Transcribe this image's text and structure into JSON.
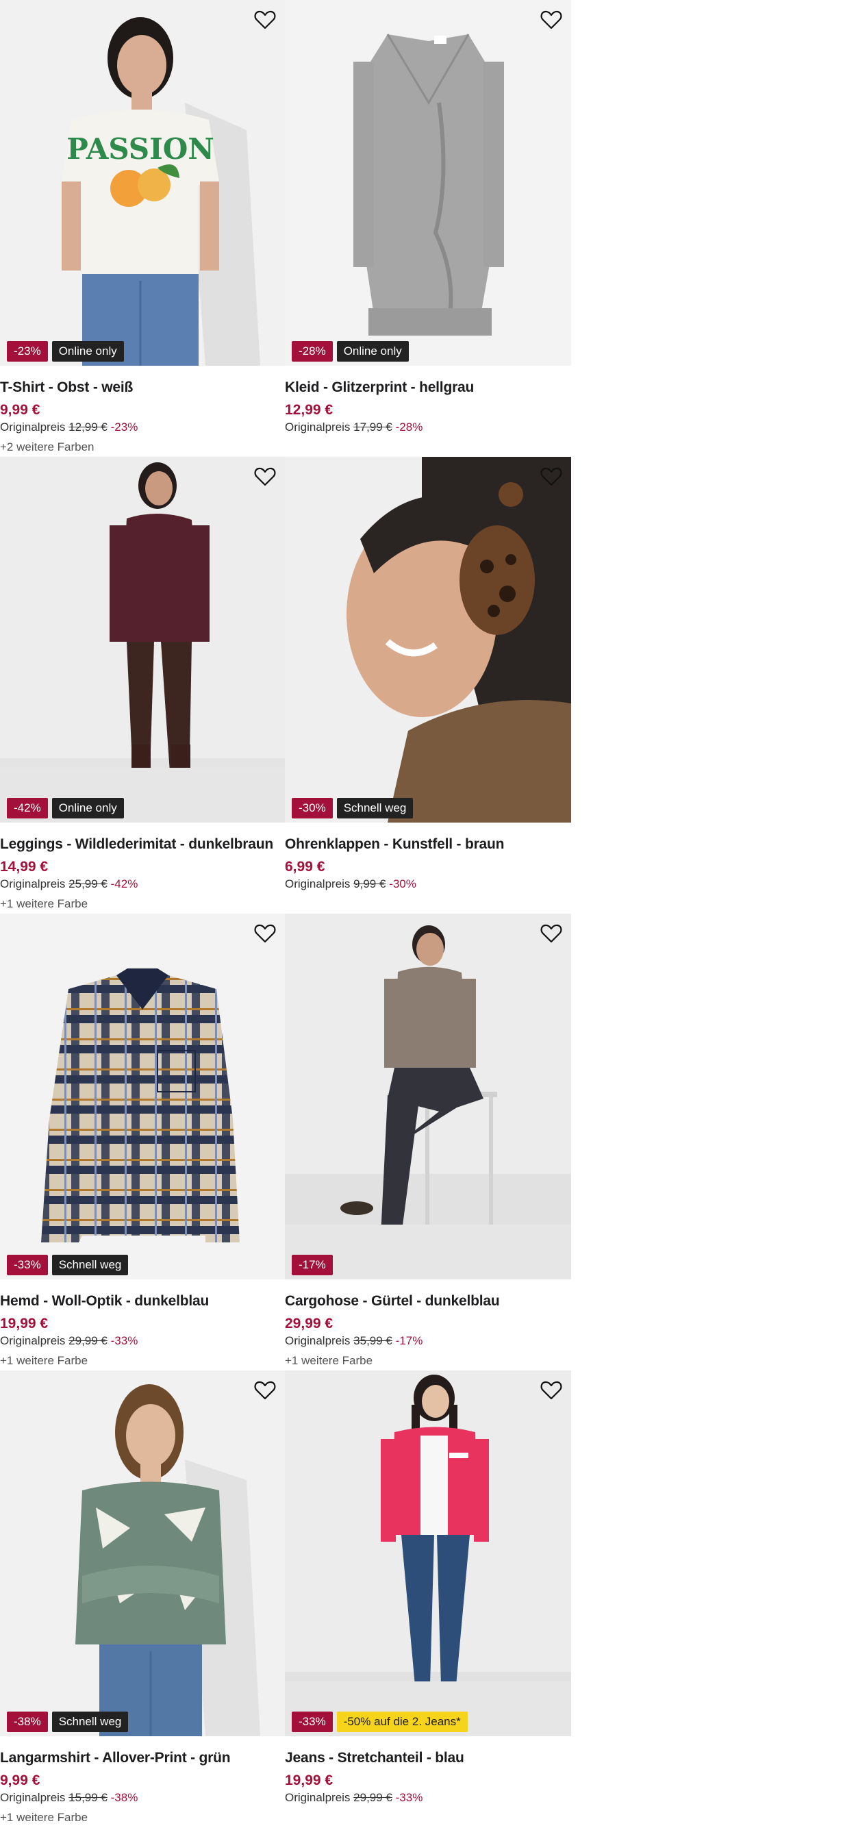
{
  "products": [
    {
      "title": "T-Shirt - Obst - weiß",
      "price": "9,99 €",
      "orig_label": "Originalpreis",
      "orig_price": "12,99 €",
      "discount": "-23%",
      "badge_sale": "-23%",
      "badge_info": "Online only",
      "colors": "+2 weitere Farben",
      "icon": "heart-icon"
    },
    {
      "title": "Kleid - Glitzerprint - hellgrau",
      "price": "12,99 €",
      "orig_label": "Originalpreis",
      "orig_price": "17,99 €",
      "discount": "-28%",
      "badge_sale": "-28%",
      "badge_info": "Online only",
      "colors": "",
      "icon": "heart-icon"
    },
    {
      "title": "Leggings - Wildlederimitat - dunkelbraun",
      "price": "14,99 €",
      "orig_label": "Originalpreis",
      "orig_price": "25,99 €",
      "discount": "-42%",
      "badge_sale": "-42%",
      "badge_info": "Online only",
      "colors": "+1 weitere Farbe",
      "icon": "heart-icon"
    },
    {
      "title": "Ohrenklappen - Kunstfell - braun",
      "price": "6,99 €",
      "orig_label": "Originalpreis",
      "orig_price": "9,99 €",
      "discount": "-30%",
      "badge_sale": "-30%",
      "badge_info": "Schnell weg",
      "colors": "",
      "icon": "heart-icon"
    },
    {
      "title": "Hemd - Woll-Optik - dunkelblau",
      "price": "19,99 €",
      "orig_label": "Originalpreis",
      "orig_price": "29,99 €",
      "discount": "-33%",
      "badge_sale": "-33%",
      "badge_info": "Schnell weg",
      "colors": "+1 weitere Farbe",
      "icon": "heart-icon"
    },
    {
      "title": "Cargohose - Gürtel - dunkelblau",
      "price": "29,99 €",
      "orig_label": "Originalpreis",
      "orig_price": "35,99 €",
      "discount": "-17%",
      "badge_sale": "-17%",
      "badge_info": "",
      "colors": "+1 weitere Farbe",
      "icon": "heart-icon"
    },
    {
      "title": "Langarmshirt - Allover-Print - grün",
      "price": "9,99 €",
      "orig_label": "Originalpreis",
      "orig_price": "15,99 €",
      "discount": "-38%",
      "badge_sale": "-38%",
      "badge_info": "Schnell weg",
      "colors": "+1 weitere Farbe",
      "icon": "heart-icon"
    },
    {
      "title": "Jeans - Stretchanteil - blau",
      "price": "19,99 €",
      "orig_label": "Originalpreis",
      "orig_price": "29,99 €",
      "discount": "-33%",
      "badge_sale": "-33%",
      "badge_promo": "-50% auf die 2. Jeans*",
      "colors": "",
      "icon": "heart-icon"
    }
  ],
  "colors": {
    "sale_red": "#a3113b",
    "info_badge": "#222222",
    "promo_yellow": "#f7d41c",
    "image_bg": "#efeff0"
  }
}
